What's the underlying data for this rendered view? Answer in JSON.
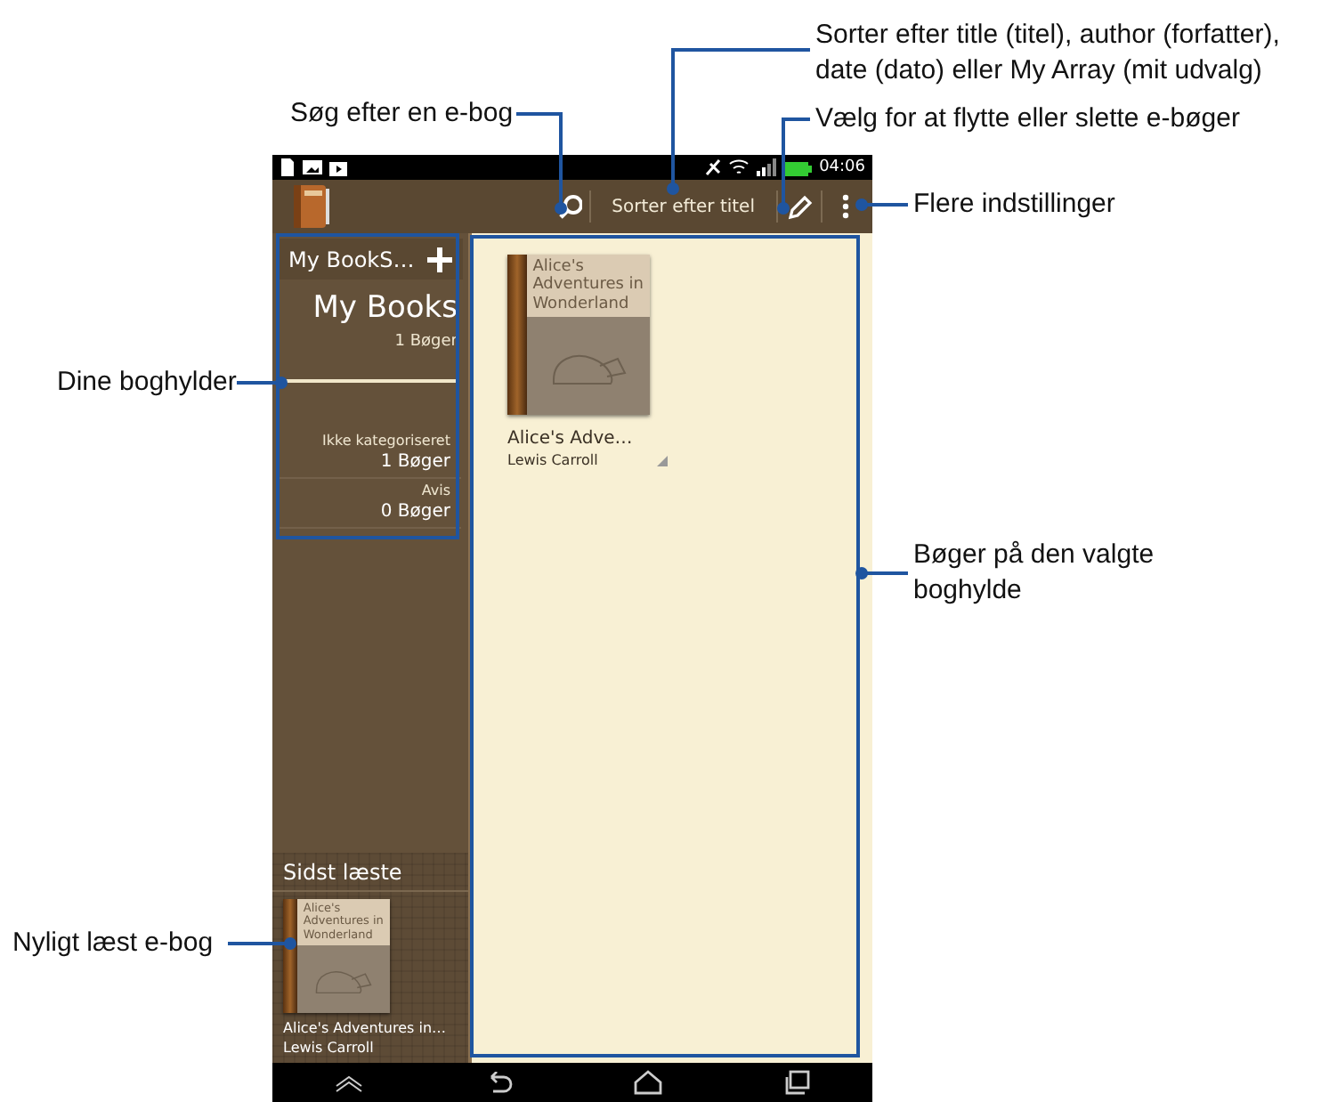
{
  "status_bar": {
    "time": "04:06"
  },
  "action_bar": {
    "sort_label": "Sorter efter titel"
  },
  "shelves_panel": {
    "header": "My BookS…",
    "current_name": "My Books",
    "current_count": "1 Bøger",
    "items": [
      {
        "name": "Ikke kategoriseret",
        "count": "1 Bøger"
      },
      {
        "name": "Avis",
        "count": "0 Bøger"
      }
    ]
  },
  "recent": {
    "heading": "Sidst læste",
    "book": {
      "cover_title": "Alice's Adventures in Wonderland",
      "title": "Alice's Adventures in…",
      "author": "Lewis Carroll"
    }
  },
  "books": [
    {
      "cover_title": "Alice's Adventures in Wonderland",
      "title": "Alice's Adve…",
      "author": "Lewis Carroll"
    }
  ],
  "callouts": [
    {
      "kind": "sort",
      "lines": [
        "Sorter efter title (titel), author (forfatter),",
        "date (dato) eller My Array (mit udvalg)"
      ]
    },
    {
      "kind": "search",
      "lines": [
        "Søg efter en e-bog"
      ]
    },
    {
      "kind": "edit",
      "lines": [
        "Vælg for at flytte eller slette e-bøger"
      ]
    },
    {
      "kind": "menu",
      "lines": [
        "Flere indstillinger"
      ]
    },
    {
      "kind": "shelves",
      "lines": [
        "Dine boghylder"
      ]
    },
    {
      "kind": "books",
      "lines": [
        "Bøger på den valgte",
        "boghylde"
      ]
    },
    {
      "kind": "recent",
      "lines": [
        "Nyligt læst e-bog"
      ]
    }
  ]
}
